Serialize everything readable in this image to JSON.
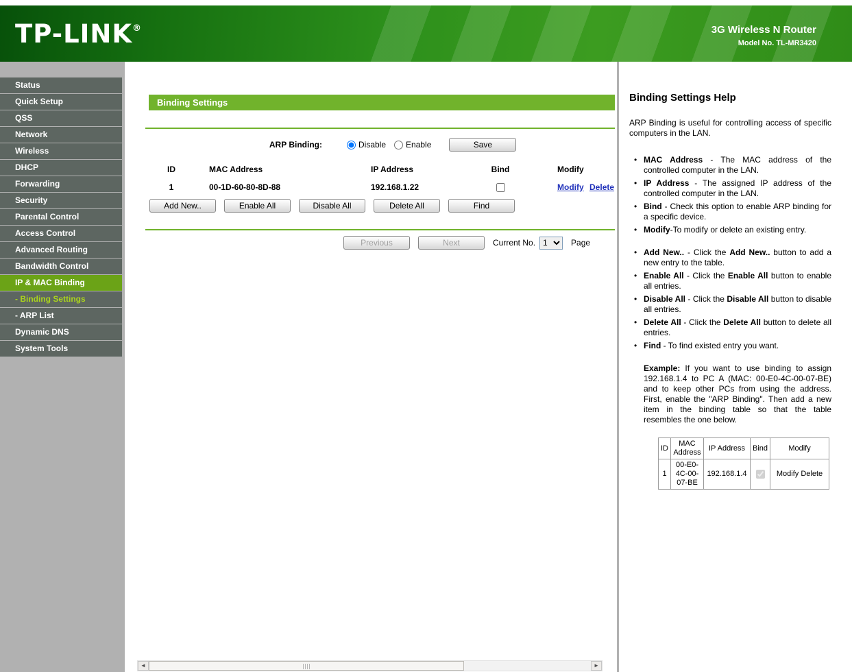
{
  "header": {
    "logo": "TP-LINK",
    "logo_reg": "®",
    "product": "3G Wireless N Router",
    "model": "Model No. TL-MR3420"
  },
  "sidebar": {
    "items": [
      {
        "label": "Status",
        "type": "main",
        "active": false
      },
      {
        "label": "Quick Setup",
        "type": "main",
        "active": false
      },
      {
        "label": "QSS",
        "type": "main",
        "active": false
      },
      {
        "label": "Network",
        "type": "main",
        "active": false
      },
      {
        "label": "Wireless",
        "type": "main",
        "active": false
      },
      {
        "label": "DHCP",
        "type": "main",
        "active": false
      },
      {
        "label": "Forwarding",
        "type": "main",
        "active": false
      },
      {
        "label": "Security",
        "type": "main",
        "active": false
      },
      {
        "label": "Parental Control",
        "type": "main",
        "active": false
      },
      {
        "label": "Access Control",
        "type": "main",
        "active": false
      },
      {
        "label": "Advanced Routing",
        "type": "main",
        "active": false
      },
      {
        "label": "Bandwidth Control",
        "type": "main",
        "active": false
      },
      {
        "label": "IP & MAC Binding",
        "type": "main",
        "active": true
      },
      {
        "label": "- Binding Settings",
        "type": "sub",
        "active": true
      },
      {
        "label": "- ARP List",
        "type": "sub",
        "active": false
      },
      {
        "label": "Dynamic DNS",
        "type": "main",
        "active": false
      },
      {
        "label": "System Tools",
        "type": "main",
        "active": false
      }
    ]
  },
  "main": {
    "title": "Binding Settings",
    "arp": {
      "label": "ARP Binding:",
      "options": [
        {
          "label": "Disable",
          "selected": true
        },
        {
          "label": "Enable",
          "selected": false
        }
      ],
      "save_label": "Save"
    },
    "table": {
      "headers": [
        "ID",
        "MAC Address",
        "IP Address",
        "Bind",
        "Modify"
      ],
      "rows": [
        {
          "id": "1",
          "mac": "00-1D-60-80-8D-88",
          "ip": "192.168.1.22",
          "bind": false,
          "modify_label": "Modify",
          "delete_label": "Delete"
        }
      ]
    },
    "buttons": [
      "Add New..",
      "Enable All",
      "Disable All",
      "Delete All",
      "Find"
    ],
    "pagination": {
      "previous": "Previous",
      "next": "Next",
      "current_label": "Current No.",
      "current_value": "1",
      "page_label": "Page"
    }
  },
  "scrollbar": {
    "left_arrow": "◄",
    "right_arrow": "►"
  },
  "help": {
    "title": "Binding Settings Help",
    "intro": "ARP Binding is useful for controlling access of specific computers in the LAN.",
    "bullets": [
      {
        "gap_before": false,
        "segments": [
          {
            "t": "MAC Address",
            "b": true
          },
          {
            "t": " - The MAC address of the controlled computer in the LAN.",
            "b": false
          }
        ]
      },
      {
        "gap_before": false,
        "segments": [
          {
            "t": "IP Address",
            "b": true
          },
          {
            "t": " - The assigned IP address of the controlled computer in the LAN.",
            "b": false
          }
        ]
      },
      {
        "gap_before": false,
        "segments": [
          {
            "t": "Bind",
            "b": true
          },
          {
            "t": " - Check this option to enable ARP binding for a specific device.",
            "b": false
          }
        ]
      },
      {
        "gap_before": false,
        "segments": [
          {
            "t": "Modify",
            "b": true
          },
          {
            "t": "-To modify or delete an existing entry.",
            "b": false
          }
        ]
      },
      {
        "gap_before": true,
        "segments": [
          {
            "t": "Add New..",
            "b": true
          },
          {
            "t": " - Click the ",
            "b": false
          },
          {
            "t": "Add New..",
            "b": true
          },
          {
            "t": " button to add a new entry to the table.",
            "b": false
          }
        ]
      },
      {
        "gap_before": false,
        "segments": [
          {
            "t": "Enable All",
            "b": true
          },
          {
            "t": " - Click the ",
            "b": false
          },
          {
            "t": "Enable All",
            "b": true
          },
          {
            "t": " button to enable all entries.",
            "b": false
          }
        ]
      },
      {
        "gap_before": false,
        "segments": [
          {
            "t": "Disable All",
            "b": true
          },
          {
            "t": " - Click the ",
            "b": false
          },
          {
            "t": "Disable All",
            "b": true
          },
          {
            "t": " button to disable all entries.",
            "b": false
          }
        ]
      },
      {
        "gap_before": false,
        "segments": [
          {
            "t": "Delete All",
            "b": true
          },
          {
            "t": " - Click the ",
            "b": false
          },
          {
            "t": "Delete All",
            "b": true
          },
          {
            "t": " button to delete all entries.",
            "b": false
          }
        ]
      },
      {
        "gap_before": false,
        "segments": [
          {
            "t": "Find",
            "b": true
          },
          {
            "t": " - To find existed entry you want.",
            "b": false
          }
        ]
      }
    ],
    "example_label": "Example:",
    "example_text": " If you want to use binding to assign 192.168.1.4 to PC A (MAC: 00-E0-4C-00-07-BE) and to keep other PCs from using the address. First, enable the \"ARP Binding\". Then add a new item in the binding table so that the table resembles the one below.",
    "table": {
      "headers": [
        "ID",
        "MAC Address",
        "IP Address",
        "Bind",
        "Modify"
      ],
      "row": {
        "id": "1",
        "mac": "00-E0-4C-00-07-BE",
        "ip": "192.168.1.4",
        "bind": true,
        "modify": "Modify Delete"
      }
    }
  }
}
